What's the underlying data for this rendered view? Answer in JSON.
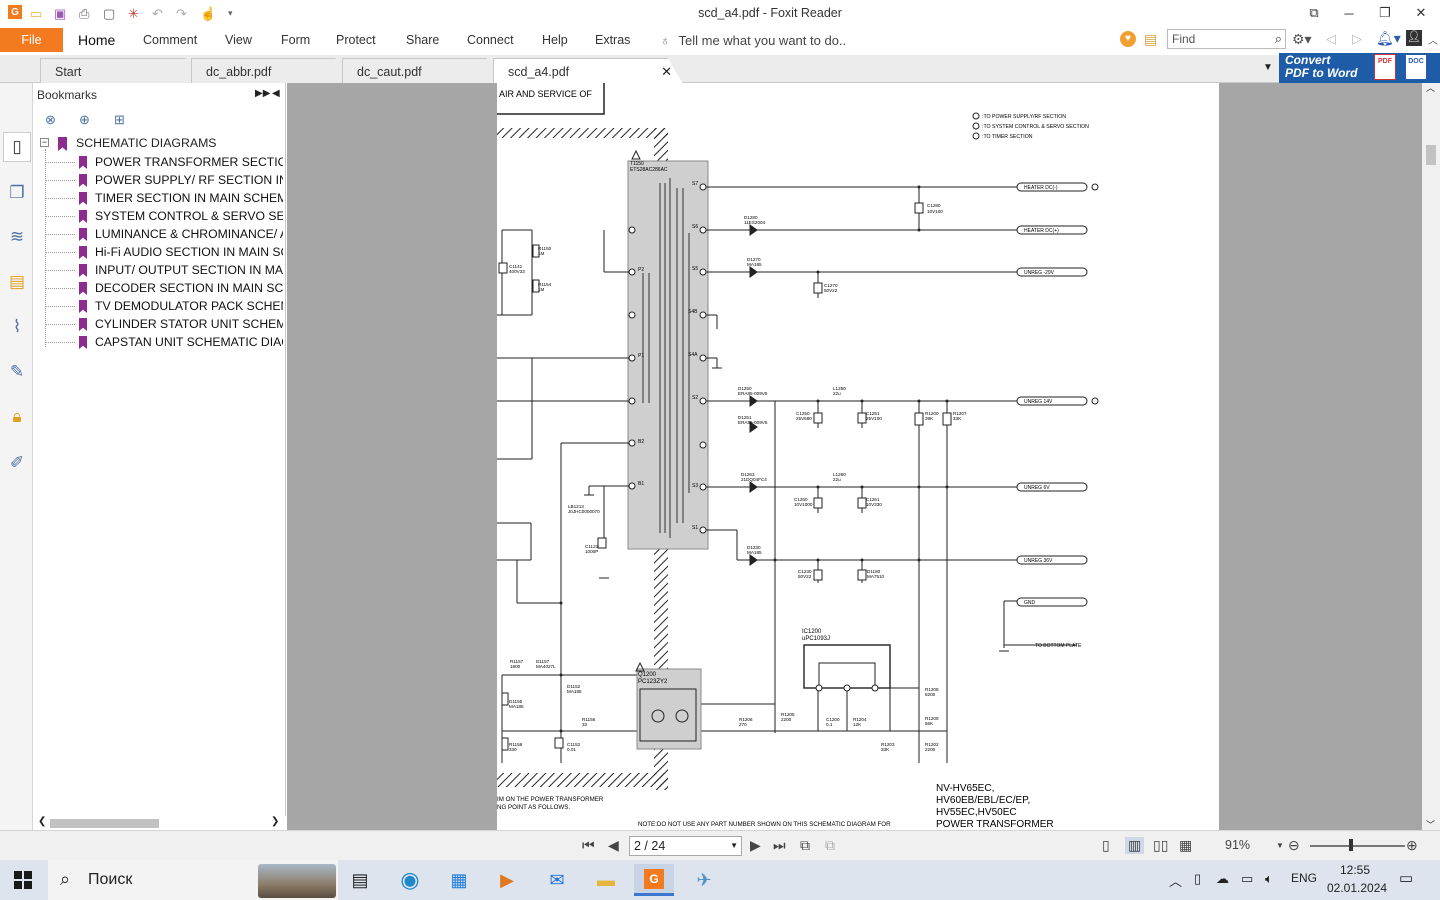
{
  "window": {
    "title": "scd_a4.pdf - Foxit Reader"
  },
  "ribbon": {
    "file_label": "File",
    "tabs": [
      "Home",
      "Comment",
      "View",
      "Form",
      "Protect",
      "Share",
      "Connect",
      "Help",
      "Extras"
    ],
    "tell_me_placeholder": "Tell me what you want to do..",
    "find_placeholder": "Find"
  },
  "doc_tabs": [
    "Start",
    "dc_abbr.pdf",
    "dc_caut.pdf",
    "scd_a4.pdf"
  ],
  "convert": {
    "line1": "Convert",
    "line2": "PDF to Word",
    "pdf_icon": "PDF",
    "doc_icon": "DOC"
  },
  "bookmarks": {
    "header": "Bookmarks",
    "root": "SCHEMATIC DIAGRAMS",
    "items": [
      "POWER TRANSFORMER SECTION",
      "POWER SUPPLY/ RF SECTION IN MAIN",
      "TIMER SECTION IN MAIN SCHEMATIC",
      "SYSTEM CONTROL & SERVO SECTION",
      "LUMINANCE & CHROMINANCE/ AUDIO",
      "Hi-Fi AUDIO SECTION IN MAIN SCHEMATIC",
      "INPUT/ OUTPUT SECTION IN MAIN",
      "DECODER SECTION IN MAIN SCHEMATIC",
      "TV DEMODULATOR PACK SCHEMATIC",
      "CYLINDER STATOR UNIT SCHEMATIC",
      "CAPSTAN UNIT SCHEMATIC DIAGRAM"
    ]
  },
  "pdf": {
    "header_box": "AIR AND SERVICE OF",
    "legend": [
      ":TO POWER SUPPLY/RF SECTION",
      ":TO SYSTEM CONTROL & SERVO SECTION",
      ":TO TIMER SECTION"
    ],
    "transformer": {
      "ref": "T1150",
      "part": "ETS28AC286AC"
    },
    "connectors": [
      "HEATER DC(-)",
      "HEATER DC(+)",
      "UNREG -29V",
      "UNREG 14V",
      "UNREG 6V",
      "UNREG 36V",
      "GND"
    ],
    "to_bottom_plate": "TO BOTTOM PLATE",
    "q1200": {
      "ref": "Q1200",
      "part": "PC123ZY2"
    },
    "ic1200": {
      "ref": "IC1200",
      "part": "uPC1093J"
    },
    "model_lines": [
      "NV-HV65EC,",
      "HV60EB/EBL/EC/EP,",
      "HV55EC,HV50EC",
      "POWER TRANSFORMER"
    ],
    "note": "NOTE:DO NOT USE ANY PART NUMBER SHOWN ON THIS SCHEMATIC DIAGRAM FOR",
    "bottom_left": [
      "IM ON THE POWER TRANSFORMER",
      "NG POINT AS FOLLOWS."
    ]
  },
  "status": {
    "page": "2 / 24",
    "zoom": "91%"
  },
  "taskbar": {
    "search": "Поиск",
    "lang": "ENG",
    "time": "12:55",
    "date": "02.01.2024"
  }
}
